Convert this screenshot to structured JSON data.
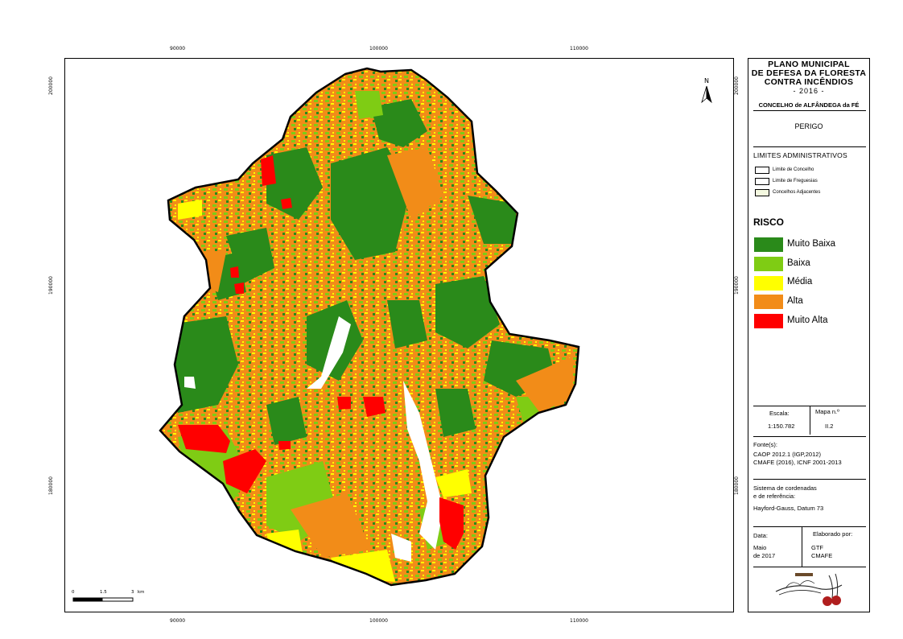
{
  "map": {
    "x_ticks": [
      "90000",
      "100000",
      "110000"
    ],
    "y_ticks": [
      "200000",
      "190000",
      "180000"
    ],
    "north_label": "N",
    "scale_bar": {
      "labels": [
        "0",
        "1.5",
        "3"
      ],
      "unit": "km"
    }
  },
  "legend": {
    "title": [
      "PLANO MUNICIPAL",
      "DE DEFESA DA FLORESTA",
      "CONTRA INCÊNDIOS",
      "- 2016 -"
    ],
    "municipality": "CONCELHO de ALFÂNDEGA da FÉ",
    "map_theme": "PERIGO",
    "admin_title": "LIMITES ADMINISTRATIVOS",
    "admin_items": [
      {
        "label": "Limite de Concelho",
        "fill": "#ffffff"
      },
      {
        "label": "Limite de Freguesias",
        "fill": "#ffffff"
      },
      {
        "label": "Concelhos Adjacentes",
        "fill": "#f4f9e0"
      }
    ],
    "risk_title": "RISCO",
    "risk_classes": [
      {
        "label": "Muito Baixa",
        "color": "#2a8a1a"
      },
      {
        "label": "Baixa",
        "color": "#7fcc14"
      },
      {
        "label": "Média",
        "color": "#ffff00"
      },
      {
        "label": "Alta",
        "color": "#f28c18"
      },
      {
        "label": "Muito Alta",
        "color": "#ff0000"
      }
    ],
    "scale_label": "Escala:",
    "scale_value": "1:150.782",
    "map_number_label": "Mapa n.º",
    "map_number_value": "II.2",
    "sources_label": "Fonte(s):",
    "sources": [
      "CAOP 2012.1 (IGP,2012)",
      "CMAFE (2016), ICNF 2001-2013"
    ],
    "crs_label": [
      "Sistema de cordenadas",
      "e de referência:"
    ],
    "crs_value": "Hayford-Gauss, Datum 73",
    "date_label": "Data:",
    "date_value": [
      "Maio",
      "de 2017"
    ],
    "author_label": "Elaborado por:",
    "author_value": [
      "GTF",
      "CMAFE"
    ],
    "logo_icon": "alfandega-da-fe-municipality-logo-icon"
  }
}
